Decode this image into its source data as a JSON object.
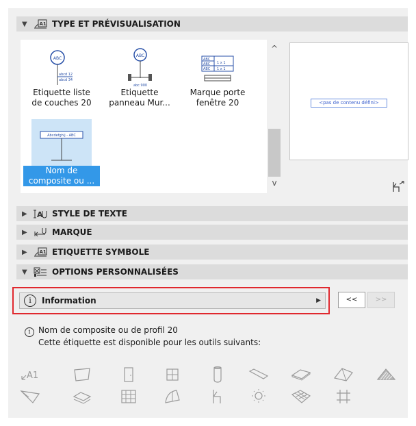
{
  "sections": {
    "type": {
      "label": "TYPE ET PRÉVISUALISATION",
      "arrow": "▼",
      "icon": "label-a1-icon"
    },
    "text_style": {
      "label": "STYLE DE TEXTE",
      "arrow": "▶",
      "icon": "text-style-icon"
    },
    "marker": {
      "label": "MARQUE",
      "arrow": "▶",
      "icon": "marker-icon"
    },
    "symbol_label": {
      "label": "ETIQUETTE SYMBOLE",
      "arrow": "▶",
      "icon": "symbol-label-icon"
    },
    "custom_options": {
      "label": "OPTIONS PERSONNALISÉES",
      "arrow": "▼",
      "icon": "custom-options-icon"
    }
  },
  "library": {
    "items": [
      {
        "line1": "Etiquette liste",
        "line2": "de couches 20",
        "icon": "layer-list-label-icon",
        "thumb_text": [
          "ABC",
          "abcd 12",
          "abcd 34"
        ]
      },
      {
        "line1": "Etiquette",
        "line2": "panneau Mur...",
        "icon": "wall-panel-label-icon",
        "thumb_text": [
          "ABC",
          "abc 900"
        ]
      },
      {
        "line1": "Marque porte",
        "line2": "fenêtre 20",
        "icon": "door-window-marker-icon",
        "thumb_text": [
          "ABC",
          "ABC",
          "ABC",
          "1 x 1",
          "1 x 1"
        ]
      },
      {
        "line1": "Nom de",
        "line2": "composite ou ...",
        "icon": "composite-name-label-icon",
        "selected": true,
        "thumb_text": [
          "Abcdefghij - ABC"
        ]
      }
    ],
    "scroll_up": "^",
    "scroll_down": "v"
  },
  "preview": {
    "text": "<pas de contenu défini>"
  },
  "info": {
    "glyph": "i",
    "label": "Information",
    "dropdown_glyph": "▶"
  },
  "nav": {
    "prev": "<<",
    "next": ">>"
  },
  "description": {
    "glyph": "i",
    "line1": "Nom de composite ou de profil 20",
    "line2": "Cette étiquette est disponible pour les outils suivants:"
  },
  "tool_icons": {
    "row1": [
      {
        "icon": "label-tool-icon",
        "text": "A1"
      },
      {
        "icon": "fill-tool-icon"
      },
      {
        "icon": "door-tool-icon"
      },
      {
        "icon": "window-tool-icon"
      },
      {
        "icon": "column-tool-icon"
      },
      {
        "icon": "beam-tool-icon"
      },
      {
        "icon": "slab-tool-icon"
      },
      {
        "icon": "roof-tool-icon"
      },
      {
        "icon": "shell-tool-icon"
      }
    ],
    "row2": [
      {
        "icon": "morph-tool-icon"
      },
      {
        "icon": "stair-tool-icon"
      },
      {
        "icon": "curtain-wall-tool-icon"
      },
      {
        "icon": "skylight-tool-icon"
      },
      {
        "icon": "object-tool-icon"
      },
      {
        "icon": "lamp-tool-icon"
      },
      {
        "icon": "mesh-tool-icon"
      },
      {
        "icon": "zone-tool-icon"
      }
    ]
  },
  "colors": {
    "selection": "#3398e8",
    "highlight_frame": "#e0282e",
    "header_bg": "#dcdcdc",
    "panel_bg": "#f0f0f0"
  }
}
